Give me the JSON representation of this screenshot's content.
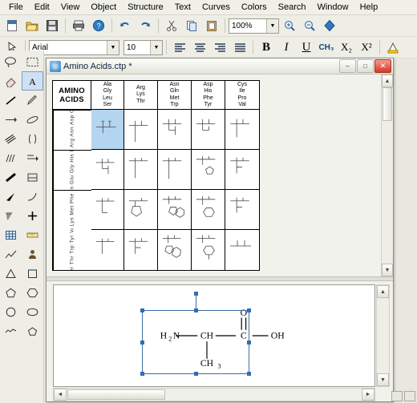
{
  "menubar": {
    "items": [
      {
        "label": "File"
      },
      {
        "label": "Edit"
      },
      {
        "label": "View"
      },
      {
        "label": "Object"
      },
      {
        "label": "Structure"
      },
      {
        "label": "Text"
      },
      {
        "label": "Curves"
      },
      {
        "label": "Colors"
      },
      {
        "label": "Search"
      },
      {
        "label": "Window"
      },
      {
        "label": "Help"
      }
    ]
  },
  "toolbar_main": {
    "buttons": [
      {
        "name": "new-document",
        "icon": "page-icon"
      },
      {
        "name": "open-document",
        "icon": "folder-icon"
      },
      {
        "name": "save-document",
        "icon": "floppy-icon"
      },
      {
        "name": "print",
        "icon": "printer-icon"
      },
      {
        "name": "help",
        "icon": "question-icon"
      },
      {
        "name": "undo",
        "icon": "undo-arrow-icon"
      },
      {
        "name": "redo",
        "icon": "redo-arrow-icon"
      },
      {
        "name": "cut",
        "icon": "scissors-icon"
      },
      {
        "name": "copy",
        "icon": "copy-icon"
      },
      {
        "name": "paste",
        "icon": "clipboard-icon"
      },
      {
        "name": "zoom-in",
        "icon": "magnifier-plus-icon"
      },
      {
        "name": "zoom-out",
        "icon": "magnifier-minus-icon"
      },
      {
        "name": "cleanup-structure",
        "icon": "blue-diamond-icon"
      }
    ],
    "zoom_value": "100%"
  },
  "toolbar_format": {
    "font_value": "Arial",
    "size_value": "10",
    "align_buttons": [
      {
        "name": "align-left",
        "icon": "align-left-icon"
      },
      {
        "name": "align-center",
        "icon": "align-center-icon"
      },
      {
        "name": "align-right",
        "icon": "align-right-icon"
      },
      {
        "name": "align-justify",
        "icon": "align-justify-icon"
      }
    ],
    "bold_label": "B",
    "italic_label": "I",
    "underline_label": "U",
    "formula_label": "CH₃",
    "subscript_label": "X₂",
    "superscript_label": "X²",
    "color_swatch": "#ffcc00"
  },
  "left_palette": {
    "tools": [
      {
        "name": "lasso-select-tool",
        "icon": "lasso-icon",
        "selected": false
      },
      {
        "name": "marquee-select-tool",
        "icon": "dashed-rect-icon",
        "selected": false
      },
      {
        "name": "eraser-tool",
        "icon": "eraser-icon",
        "selected": false
      },
      {
        "name": "text-tool",
        "icon": "letter-a-icon",
        "selected": true
      },
      {
        "name": "solid-bond-tool",
        "icon": "line-icon",
        "selected": false
      },
      {
        "name": "pen-tool",
        "icon": "pen-icon",
        "selected": false
      },
      {
        "name": "arrow-tool",
        "icon": "arrow-icon",
        "selected": false
      },
      {
        "name": "orbital-tool",
        "icon": "orbital-icon",
        "selected": false
      },
      {
        "name": "multi-bond-tool",
        "icon": "triple-line-icon",
        "selected": false
      },
      {
        "name": "bracket-tool",
        "icon": "bracket-icon",
        "selected": false
      },
      {
        "name": "hash-bond-tool",
        "icon": "hash-lines-icon",
        "selected": false
      },
      {
        "name": "reaction-arrow-tool",
        "icon": "reaction-arrow-icon"
      },
      {
        "name": "bold-bond-tool",
        "icon": "bold-line-icon"
      },
      {
        "name": "chain-tool",
        "icon": "chain-icon"
      },
      {
        "name": "wedge-bond-tool",
        "icon": "wedge-icon"
      },
      {
        "name": "arc-tool",
        "icon": "arc-icon"
      },
      {
        "name": "dashed-wedge-tool",
        "icon": "dashed-wedge-icon"
      },
      {
        "name": "plus-tool",
        "icon": "plus-icon"
      },
      {
        "name": "table-tool",
        "icon": "table-icon"
      },
      {
        "name": "ruler-tool",
        "icon": "ruler-icon"
      },
      {
        "name": "chart-tool",
        "icon": "chart-icon"
      },
      {
        "name": "person-tool",
        "icon": "person-icon"
      },
      {
        "name": "triangle-tool",
        "icon": "triangle-icon"
      },
      {
        "name": "square-tool",
        "icon": "square-icon"
      },
      {
        "name": "pentagon-tool",
        "icon": "pentagon-icon"
      },
      {
        "name": "hexagon-tool",
        "icon": "hexagon-icon"
      },
      {
        "name": "circle-tool",
        "icon": "circle-icon"
      },
      {
        "name": "oval-tool",
        "icon": "oval-icon"
      },
      {
        "name": "cyclohexane-chair-tool",
        "icon": "chair-icon"
      },
      {
        "name": "cyclopentane-tool",
        "icon": "cyclopentane-icon"
      }
    ]
  },
  "document_window": {
    "title": "Amino Acids.ctp *",
    "icon": "molecule-document-icon",
    "minimize_label": "–",
    "maximize_label": "□",
    "close_label": "✕"
  },
  "template_grid": {
    "corner_title_line1": "AMINO",
    "corner_title_line2": "ACIDS",
    "column_headers": [
      {
        "lines": [
          "Ala",
          "Gly",
          "Leu",
          "Ser"
        ]
      },
      {
        "lines": [
          "Arg",
          "Lys",
          "Thr"
        ]
      },
      {
        "lines": [
          "Asn",
          "Gln",
          "Met",
          "Trp"
        ]
      },
      {
        "lines": [
          "Asp",
          "His",
          "Phe",
          "Tyr"
        ]
      },
      {
        "lines": [
          "Cys",
          "Ile",
          "Pro",
          "Val"
        ]
      }
    ],
    "row_headers": [
      {
        "label": "Ala Arg Asn Asp Cys"
      },
      {
        "label": "Gln Glu Gly His Ile"
      },
      {
        "label": "Leu Lys Met Phe Pro"
      },
      {
        "label": "Ser Thr Trp Tyr Val"
      }
    ],
    "selected_cell": {
      "row": 1,
      "col": 1,
      "name": "alanine-template"
    }
  },
  "canvas": {
    "structure_name": "alanine-structure",
    "labels": {
      "amine": "H₂N",
      "alpha_carbon": "CH",
      "carbonyl_carbon": "C",
      "carbonyl_oxygen": "O",
      "hydroxyl": "OH",
      "methyl": "CH₃"
    }
  },
  "scrollbars": {
    "up_arrow": "▲",
    "down_arrow": "▼",
    "left_arrow": "◄",
    "right_arrow": "►"
  }
}
